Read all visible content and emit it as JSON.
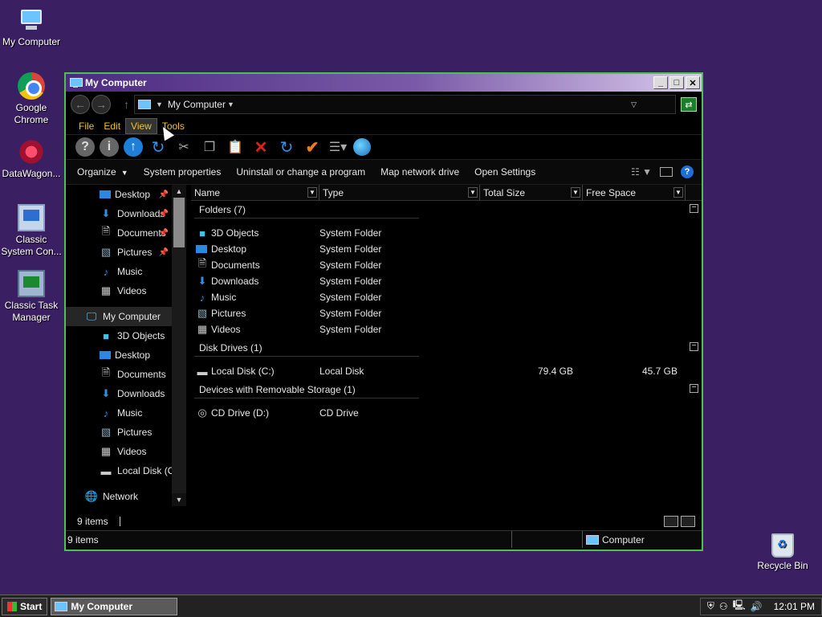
{
  "desktop": {
    "icons": [
      {
        "label": "My Computer"
      },
      {
        "label": "Google Chrome"
      },
      {
        "label": "DataWagon..."
      },
      {
        "label": "Classic System Con..."
      },
      {
        "label": "Classic Task Manager"
      },
      {
        "label": "Recycle Bin"
      }
    ]
  },
  "window": {
    "title": "My Computer",
    "buttons": {
      "minimize": "_",
      "maximize": "□",
      "close": "✕"
    },
    "address": {
      "path": "My Computer"
    },
    "menu": [
      "File",
      "Edit",
      "View",
      "Tools"
    ],
    "commands": [
      {
        "label": "Organize",
        "dropdown": true
      },
      {
        "label": "System properties"
      },
      {
        "label": "Uninstall or change a program"
      },
      {
        "label": "Map network drive"
      },
      {
        "label": "Open Settings"
      }
    ],
    "nav": [
      {
        "label": "Desktop",
        "icon": "desktop-icon",
        "pinned": true
      },
      {
        "label": "Downloads",
        "icon": "downloads-icon",
        "pinned": true
      },
      {
        "label": "Documents",
        "icon": "documents-icon",
        "pinned": true
      },
      {
        "label": "Pictures",
        "icon": "pictures-icon",
        "pinned": true
      },
      {
        "label": "Music",
        "icon": "music-icon"
      },
      {
        "label": "Videos",
        "icon": "videos-icon"
      },
      {
        "label": "My Computer",
        "icon": "computer-icon",
        "selected": true
      },
      {
        "label": "3D Objects",
        "icon": "3d-objects-icon"
      },
      {
        "label": "Desktop",
        "icon": "desktop-icon"
      },
      {
        "label": "Documents",
        "icon": "documents-icon"
      },
      {
        "label": "Downloads",
        "icon": "downloads-icon"
      },
      {
        "label": "Music",
        "icon": "music-icon"
      },
      {
        "label": "Pictures",
        "icon": "pictures-icon"
      },
      {
        "label": "Videos",
        "icon": "videos-icon"
      },
      {
        "label": "Local Disk (C:)",
        "icon": "disk-icon"
      },
      {
        "label": "Network",
        "icon": "network-icon"
      }
    ],
    "columns": [
      "Name",
      "Type",
      "Total Size",
      "Free Space"
    ],
    "groups": [
      {
        "header": "Folders (7)",
        "rows": [
          {
            "name": "3D Objects",
            "type": "System Folder",
            "total": "",
            "free": ""
          },
          {
            "name": "Desktop",
            "type": "System Folder",
            "total": "",
            "free": ""
          },
          {
            "name": "Documents",
            "type": "System Folder",
            "total": "",
            "free": ""
          },
          {
            "name": "Downloads",
            "type": "System Folder",
            "total": "",
            "free": ""
          },
          {
            "name": "Music",
            "type": "System Folder",
            "total": "",
            "free": ""
          },
          {
            "name": "Pictures",
            "type": "System Folder",
            "total": "",
            "free": ""
          },
          {
            "name": "Videos",
            "type": "System Folder",
            "total": "",
            "free": ""
          }
        ]
      },
      {
        "header": "Disk Drives (1)",
        "rows": [
          {
            "name": "Local Disk (C:)",
            "type": "Local Disk",
            "total": "79.4 GB",
            "free": "45.7 GB"
          }
        ]
      },
      {
        "header": "Devices with Removable Storage (1)",
        "rows": [
          {
            "name": "CD Drive (D:)",
            "type": "CD Drive",
            "total": "",
            "free": ""
          }
        ]
      }
    ],
    "inner_status": "9 items",
    "status": {
      "items": "9 items",
      "location": "Computer"
    }
  },
  "taskbar": {
    "start": "Start",
    "task": "My Computer",
    "clock": "12:01 PM"
  },
  "colors": {
    "accent_border": "#4bc34b",
    "menu_text": "#f0c419",
    "desktop": "#3b1f63"
  }
}
